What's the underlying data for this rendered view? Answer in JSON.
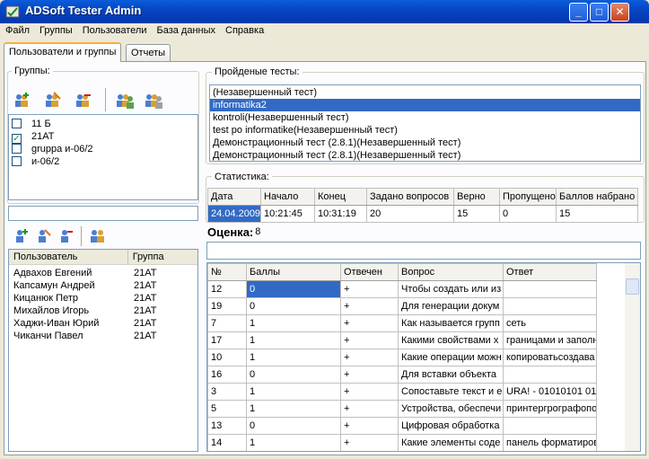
{
  "window": {
    "title": "ADSoft Tester Admin",
    "min_label": "_",
    "max_label": "□",
    "close_label": "✕"
  },
  "menu": [
    "Файл",
    "Группы",
    "Пользователи",
    "База данных",
    "Справка"
  ],
  "tabs": {
    "users": "Пользователи и группы",
    "reports": "Отчеты"
  },
  "groups": {
    "label": "Группы:",
    "items": [
      {
        "name": "11 Б",
        "checked": false
      },
      {
        "name": "21АТ",
        "checked": true
      },
      {
        "name": "gruppa и-06/2",
        "checked": false
      },
      {
        "name": "и-06/2",
        "checked": false
      }
    ]
  },
  "users": {
    "headers": [
      "Пользователь",
      "Группа"
    ],
    "rows": [
      [
        "Адвахов Евгений",
        "21АТ"
      ],
      [
        "Капсамун Андрей",
        "21АТ"
      ],
      [
        "Кицанюк Петр",
        "21АТ"
      ],
      [
        "Михайлов Игорь",
        "21АТ"
      ],
      [
        "Хаджи-Иван Юрий",
        "21АТ"
      ],
      [
        "Чиканчи Павел",
        "21АТ"
      ]
    ]
  },
  "tests": {
    "label": "Пройденые тесты:",
    "items": [
      "(Незавершенный тест)",
      "informatika2",
      "kontroli(Незавершенный тест)",
      "test po informatike(Незавершенный тест)",
      "Демонстрационный тест (2.8.1)(Незавершенный тест)",
      "Демонстрационный тест (2.8.1)(Незавершенный тест)"
    ],
    "selected_index": 1
  },
  "stats": {
    "label": "Статистика:",
    "headers": [
      "Дата",
      "Начало",
      "Конец",
      "Задано вопросов",
      "Верно",
      "Пропущено",
      "Баллов набрано"
    ],
    "row": [
      "24.04.2009",
      "10:21:45",
      "10:31:19",
      "20",
      "15",
      "0",
      "15"
    ]
  },
  "grade": {
    "label": "Оценка:",
    "value": "8"
  },
  "answers": {
    "headers": [
      "№",
      "Баллы",
      "Отвечен",
      "Вопрос",
      "Ответ"
    ],
    "rows": [
      [
        "12",
        "0",
        "+",
        "Чтобы создать или из",
        ""
      ],
      [
        "19",
        "0",
        "+",
        "Для генерации докум",
        ""
      ],
      [
        "7",
        "1",
        "+",
        "Как называется групп",
        "сеть"
      ],
      [
        "17",
        "1",
        "+",
        "Какими свойствами х",
        "границами и заполн"
      ],
      [
        "10",
        "1",
        "+",
        "Какие операции можн",
        "копироватьсоздава"
      ],
      [
        "16",
        "0",
        "+",
        "Для вставки объекта",
        ""
      ],
      [
        "3",
        "1",
        "+",
        "Сопоставьте текст и е",
        "URA! - 01010101  01"
      ],
      [
        "5",
        "1",
        "+",
        "Устройства, обеспечи",
        "принтергрографопост"
      ],
      [
        "13",
        "0",
        "+",
        "Цифровая обработка",
        ""
      ],
      [
        "14",
        "1",
        "+",
        "Какие элементы соде",
        "панель форматиров"
      ]
    ]
  }
}
